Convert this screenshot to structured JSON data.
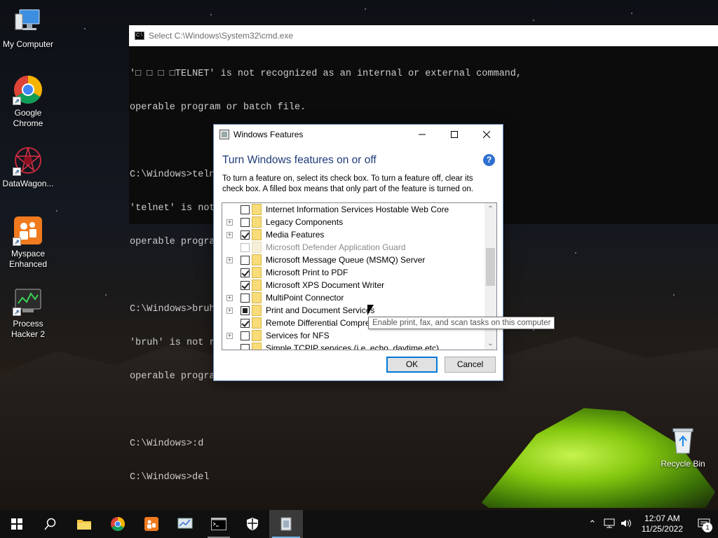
{
  "desktop": {
    "icons": [
      {
        "label": "My Computer",
        "icon": "computer-icon"
      },
      {
        "label": "Google Chrome",
        "icon": "chrome-icon"
      },
      {
        "label": "DataWagon...",
        "icon": "datawagon-icon"
      },
      {
        "label": "Myspace Enhanced",
        "icon": "myspace-icon"
      },
      {
        "label": "Process Hacker 2",
        "icon": "process-hacker-icon"
      },
      {
        "label": "Recycle Bin",
        "icon": "recycle-bin-icon"
      }
    ]
  },
  "cmd": {
    "title": "Select C:\\Windows\\System32\\cmd.exe",
    "lines": [
      "'□ □ □ □TELNET' is not recognized as an internal or external command,",
      "operable program or batch file.",
      "",
      "C:\\Windows>telnet",
      "'telnet' is not recognized as an internal or external command,",
      "operable program or batch file.",
      "",
      "C:\\Windows>bruh",
      "'bruh' is not r",
      "operable progra",
      "",
      "C:\\Windows>:d",
      "C:\\Windows>del"
    ]
  },
  "dialog": {
    "title": "Windows Features",
    "heading": "Turn Windows features on or off",
    "description": "To turn a feature on, select its check box. To turn a feature off, clear its check box. A filled box means that only part of the feature is turned on.",
    "help_symbol": "?",
    "features": [
      {
        "label": "Internet Information Services Hostable Web Core",
        "expandable": false,
        "state": "unchecked",
        "disabled": false
      },
      {
        "label": "Legacy Components",
        "expandable": true,
        "state": "unchecked",
        "disabled": false
      },
      {
        "label": "Media Features",
        "expandable": true,
        "state": "checked",
        "disabled": false
      },
      {
        "label": "Microsoft Defender Application Guard",
        "expandable": false,
        "state": "unchecked",
        "disabled": true
      },
      {
        "label": "Microsoft Message Queue (MSMQ) Server",
        "expandable": true,
        "state": "unchecked",
        "disabled": false
      },
      {
        "label": "Microsoft Print to PDF",
        "expandable": false,
        "state": "checked",
        "disabled": false
      },
      {
        "label": "Microsoft XPS Document Writer",
        "expandable": false,
        "state": "checked",
        "disabled": false
      },
      {
        "label": "MultiPoint Connector",
        "expandable": true,
        "state": "unchecked",
        "disabled": false
      },
      {
        "label": "Print and Document Services",
        "expandable": true,
        "state": "partial",
        "disabled": false
      },
      {
        "label": "Remote Differential Compres",
        "expandable": false,
        "state": "checked",
        "disabled": false
      },
      {
        "label": "Services for NFS",
        "expandable": true,
        "state": "unchecked",
        "disabled": false
      },
      {
        "label": "Simple TCPIP services (i.e. echo, daytime etc)",
        "expandable": false,
        "state": "unchecked",
        "disabled": false
      }
    ],
    "ok_label": "OK",
    "cancel_label": "Cancel",
    "tooltip": "Enable print, fax, and scan tasks on this computer"
  },
  "taskbar": {
    "items": [
      {
        "icon": "windows-start-icon",
        "state": "normal"
      },
      {
        "icon": "search-icon",
        "state": "normal"
      },
      {
        "icon": "file-explorer-icon",
        "state": "normal"
      },
      {
        "icon": "chrome-icon",
        "state": "normal"
      },
      {
        "icon": "myspace-icon",
        "state": "normal"
      },
      {
        "icon": "control-panel-icon",
        "state": "normal"
      },
      {
        "icon": "cmd-icon",
        "state": "open"
      },
      {
        "icon": "windows-security-icon",
        "state": "normal"
      },
      {
        "icon": "windows-features-icon",
        "state": "active"
      }
    ],
    "time": "12:07 AM",
    "date": "11/25/2022",
    "notification_count": "1"
  },
  "colors": {
    "heading": "#1e3b7a",
    "accent": "#0078d7",
    "help": "#2f6fd1",
    "tent": "#8ad10f"
  }
}
